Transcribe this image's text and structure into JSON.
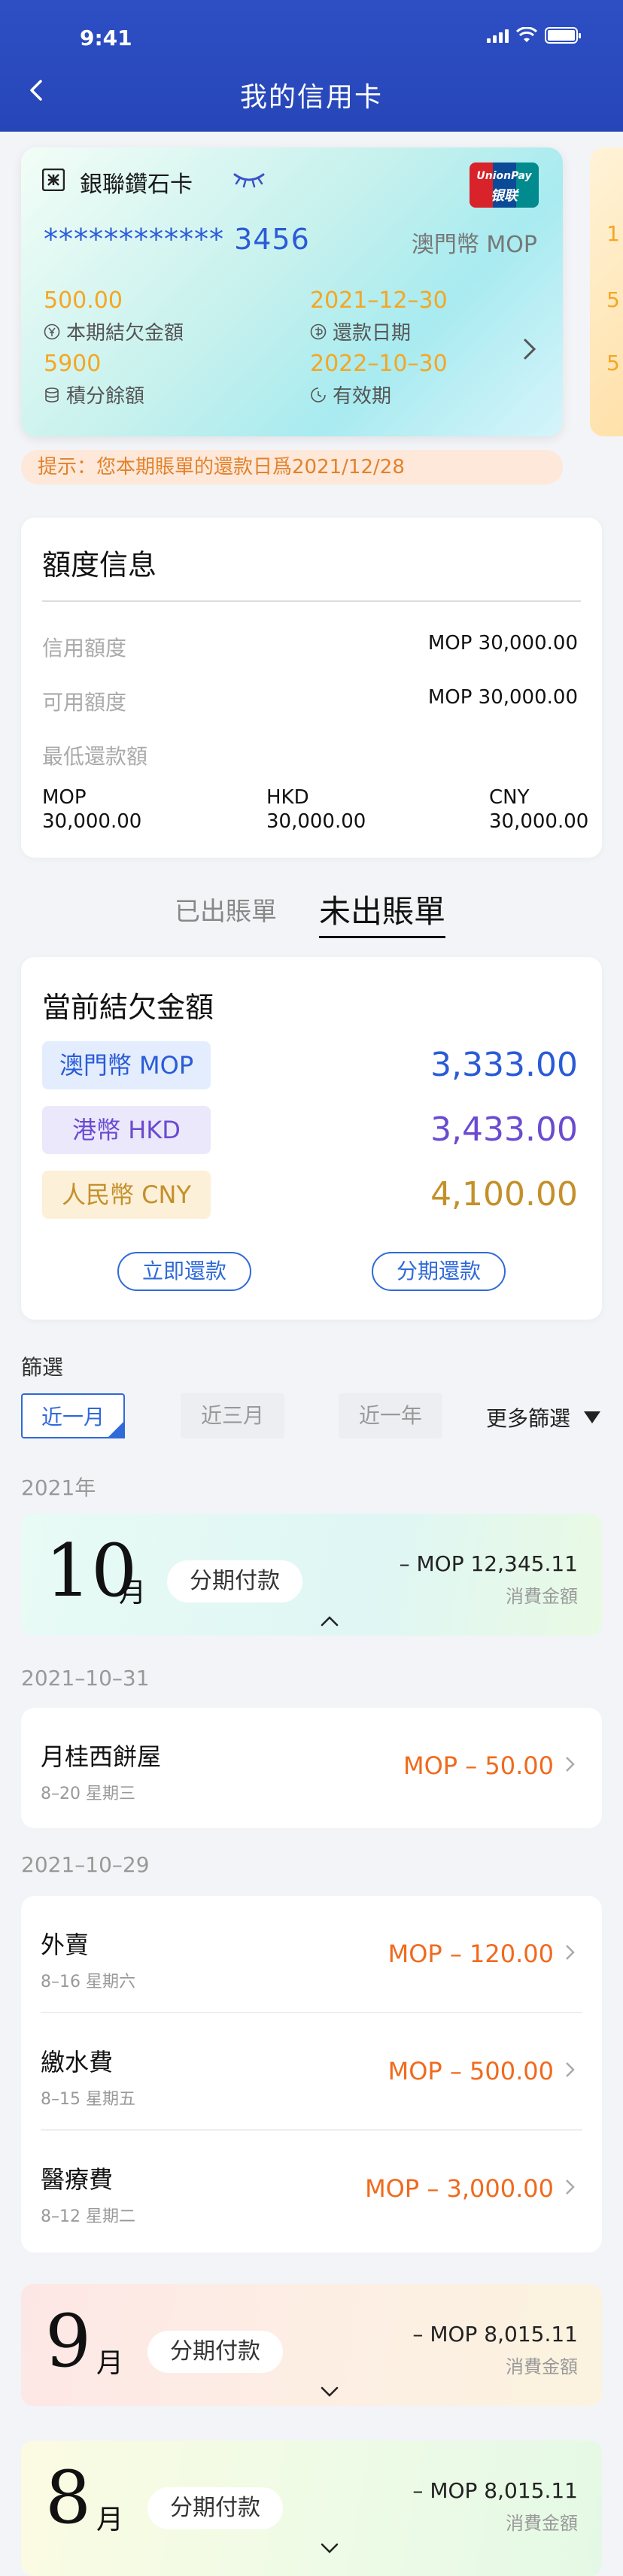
{
  "status": {
    "time": "9:41"
  },
  "header": {
    "title": "我的信用卡"
  },
  "card": {
    "name": "銀聯鑽石卡",
    "brand_en": "UnionPay",
    "brand_cn": "银联",
    "number": "************ 3456",
    "currency": "澳門幣 MOP",
    "balance_value": "500.00",
    "balance_label": "本期結欠金額",
    "due_value": "2021–12–30",
    "due_label": "還款日期",
    "points_value": "5900",
    "points_label": "積分餘額",
    "expiry_value": "2022–10–30",
    "expiry_label": "有效期",
    "peek": [
      "1",
      "5",
      "5"
    ]
  },
  "notice": "提示：您本期賬單的還款日爲2021/12/28",
  "credit": {
    "title": "額度信息",
    "rows": [
      {
        "label": "信用額度",
        "value": "MOP  30,000.00"
      },
      {
        "label": "可用額度",
        "value": "MOP  30,000.00"
      },
      {
        "label": "最低還款額",
        "value": ""
      }
    ],
    "min_pay": [
      {
        "cur": "MOP",
        "amt": "30,000.00"
      },
      {
        "cur": "HKD",
        "amt": "30,000.00"
      },
      {
        "cur": "CNY",
        "amt": "30,000.00"
      }
    ]
  },
  "tabs": {
    "billed": "已出賬單",
    "unbilled": "未出賬單"
  },
  "current": {
    "title": "當前結欠金額",
    "items": [
      {
        "label": "澳門幣 MOP",
        "amount": "3,333.00",
        "color": "#2a5bd7",
        "bg": "#e3edfd"
      },
      {
        "label": "港幣 HKD",
        "amount": "3,433.00",
        "color": "#6a4bd0",
        "bg": "#ece8fb"
      },
      {
        "label": "人民幣 CNY",
        "amount": "4,100.00",
        "color": "#c4902a",
        "bg": "#fdf0d9"
      }
    ],
    "pay_now": "立即還款",
    "installment": "分期還款"
  },
  "filter": {
    "title": "篩選",
    "chips": [
      "近一月",
      "近三月",
      "近一年"
    ],
    "more": "更多篩選"
  },
  "year": "2021年",
  "months": [
    {
      "num": "10",
      "unit": "月",
      "inst": "分期付款",
      "amount": "– MOP 12,345.11",
      "sub": "消費金額",
      "expanded": true
    },
    {
      "num": "9",
      "unit": "月",
      "inst": "分期付款",
      "amount": "– MOP 8,015.11",
      "sub": "消費金額",
      "expanded": false
    },
    {
      "num": "8",
      "unit": "月",
      "inst": "分期付款",
      "amount": "– MOP 8,015.11",
      "sub": "消費金額",
      "expanded": false
    }
  ],
  "groups": [
    {
      "date": "2021–10–31",
      "items": [
        {
          "name": "月桂西餅屋",
          "date": "8–20 星期三",
          "amount": "MOP – 50.00"
        }
      ]
    },
    {
      "date": "2021–10–29",
      "items": [
        {
          "name": "外賣",
          "date": "8–16 星期六",
          "amount": "MOP – 120.00"
        },
        {
          "name": "繳水費",
          "date": "8–15 星期五",
          "amount": "MOP – 500.00"
        },
        {
          "name": "醫療費",
          "date": "8–12 星期二",
          "amount": "MOP – 3,000.00"
        }
      ]
    }
  ]
}
